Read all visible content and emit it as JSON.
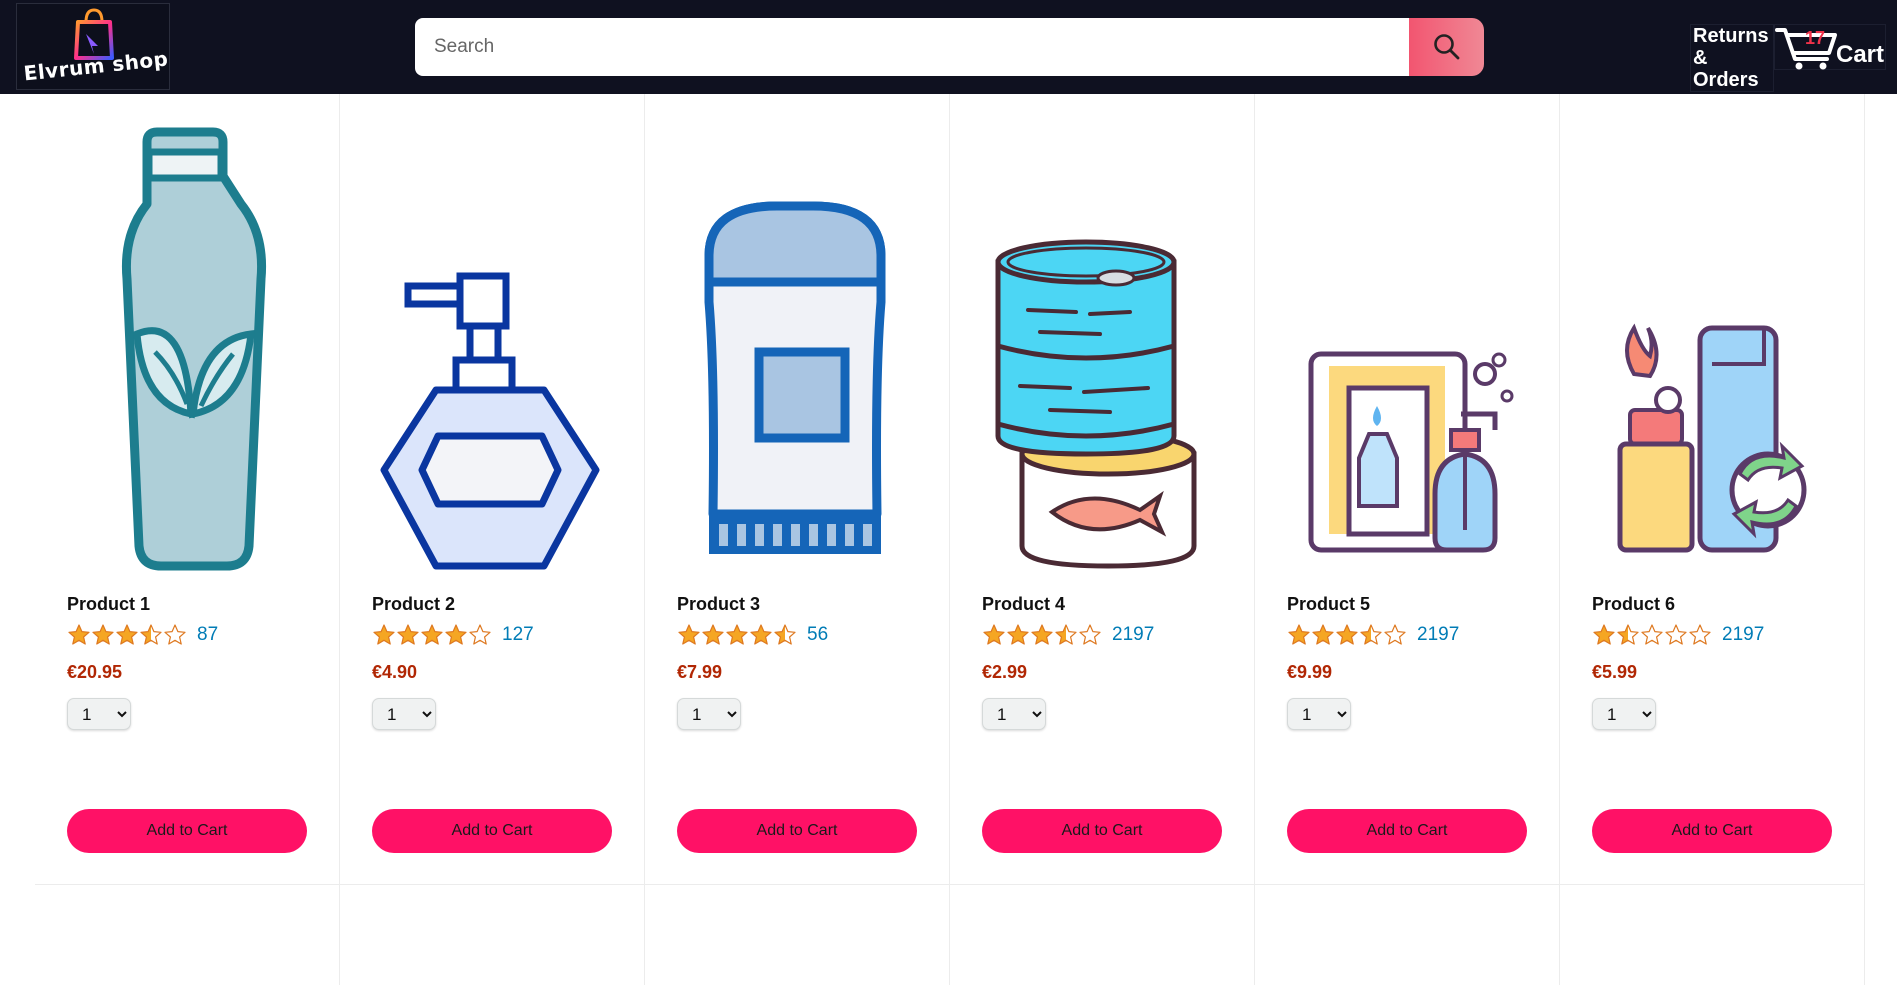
{
  "header": {
    "logo_text": "Elvrum shop",
    "search_placeholder": "Search",
    "returns_label_line1": "Returns",
    "returns_label_line2": "& Orders",
    "cart_count": "17",
    "cart_label": "Cart"
  },
  "products": [
    {
      "name": "Product 1",
      "rating": 3.5,
      "rating_count": "87",
      "price": "€20.95",
      "qty": "1",
      "add_label": "Add to Cart",
      "icon": "shampoo-bottle-icon"
    },
    {
      "name": "Product 2",
      "rating": 4,
      "rating_count": "127",
      "price": "€4.90",
      "qty": "1",
      "add_label": "Add to Cart",
      "icon": "perfume-pump-bottle-icon"
    },
    {
      "name": "Product 3",
      "rating": 4.5,
      "rating_count": "56",
      "price": "€7.99",
      "qty": "1",
      "add_label": "Add to Cart",
      "icon": "deodorant-stick-icon"
    },
    {
      "name": "Product 4",
      "rating": 3.5,
      "rating_count": "2197",
      "price": "€2.99",
      "qty": "1",
      "add_label": "Add to Cart",
      "icon": "canned-fish-icon"
    },
    {
      "name": "Product 5",
      "rating": 3.5,
      "rating_count": "2197",
      "price": "€9.99",
      "qty": "1",
      "add_label": "Add to Cart",
      "icon": "soap-refill-icon"
    },
    {
      "name": "Product 6",
      "rating": 1.5,
      "rating_count": "2197",
      "price": "€5.99",
      "qty": "1",
      "add_label": "Add to Cart",
      "icon": "recyclable-containers-icon"
    }
  ],
  "colors": {
    "header_bg": "#0f1120",
    "add_button": "#ff1166",
    "price": "#b12704",
    "rating_link": "#017cb6",
    "star": "#f5a623"
  }
}
